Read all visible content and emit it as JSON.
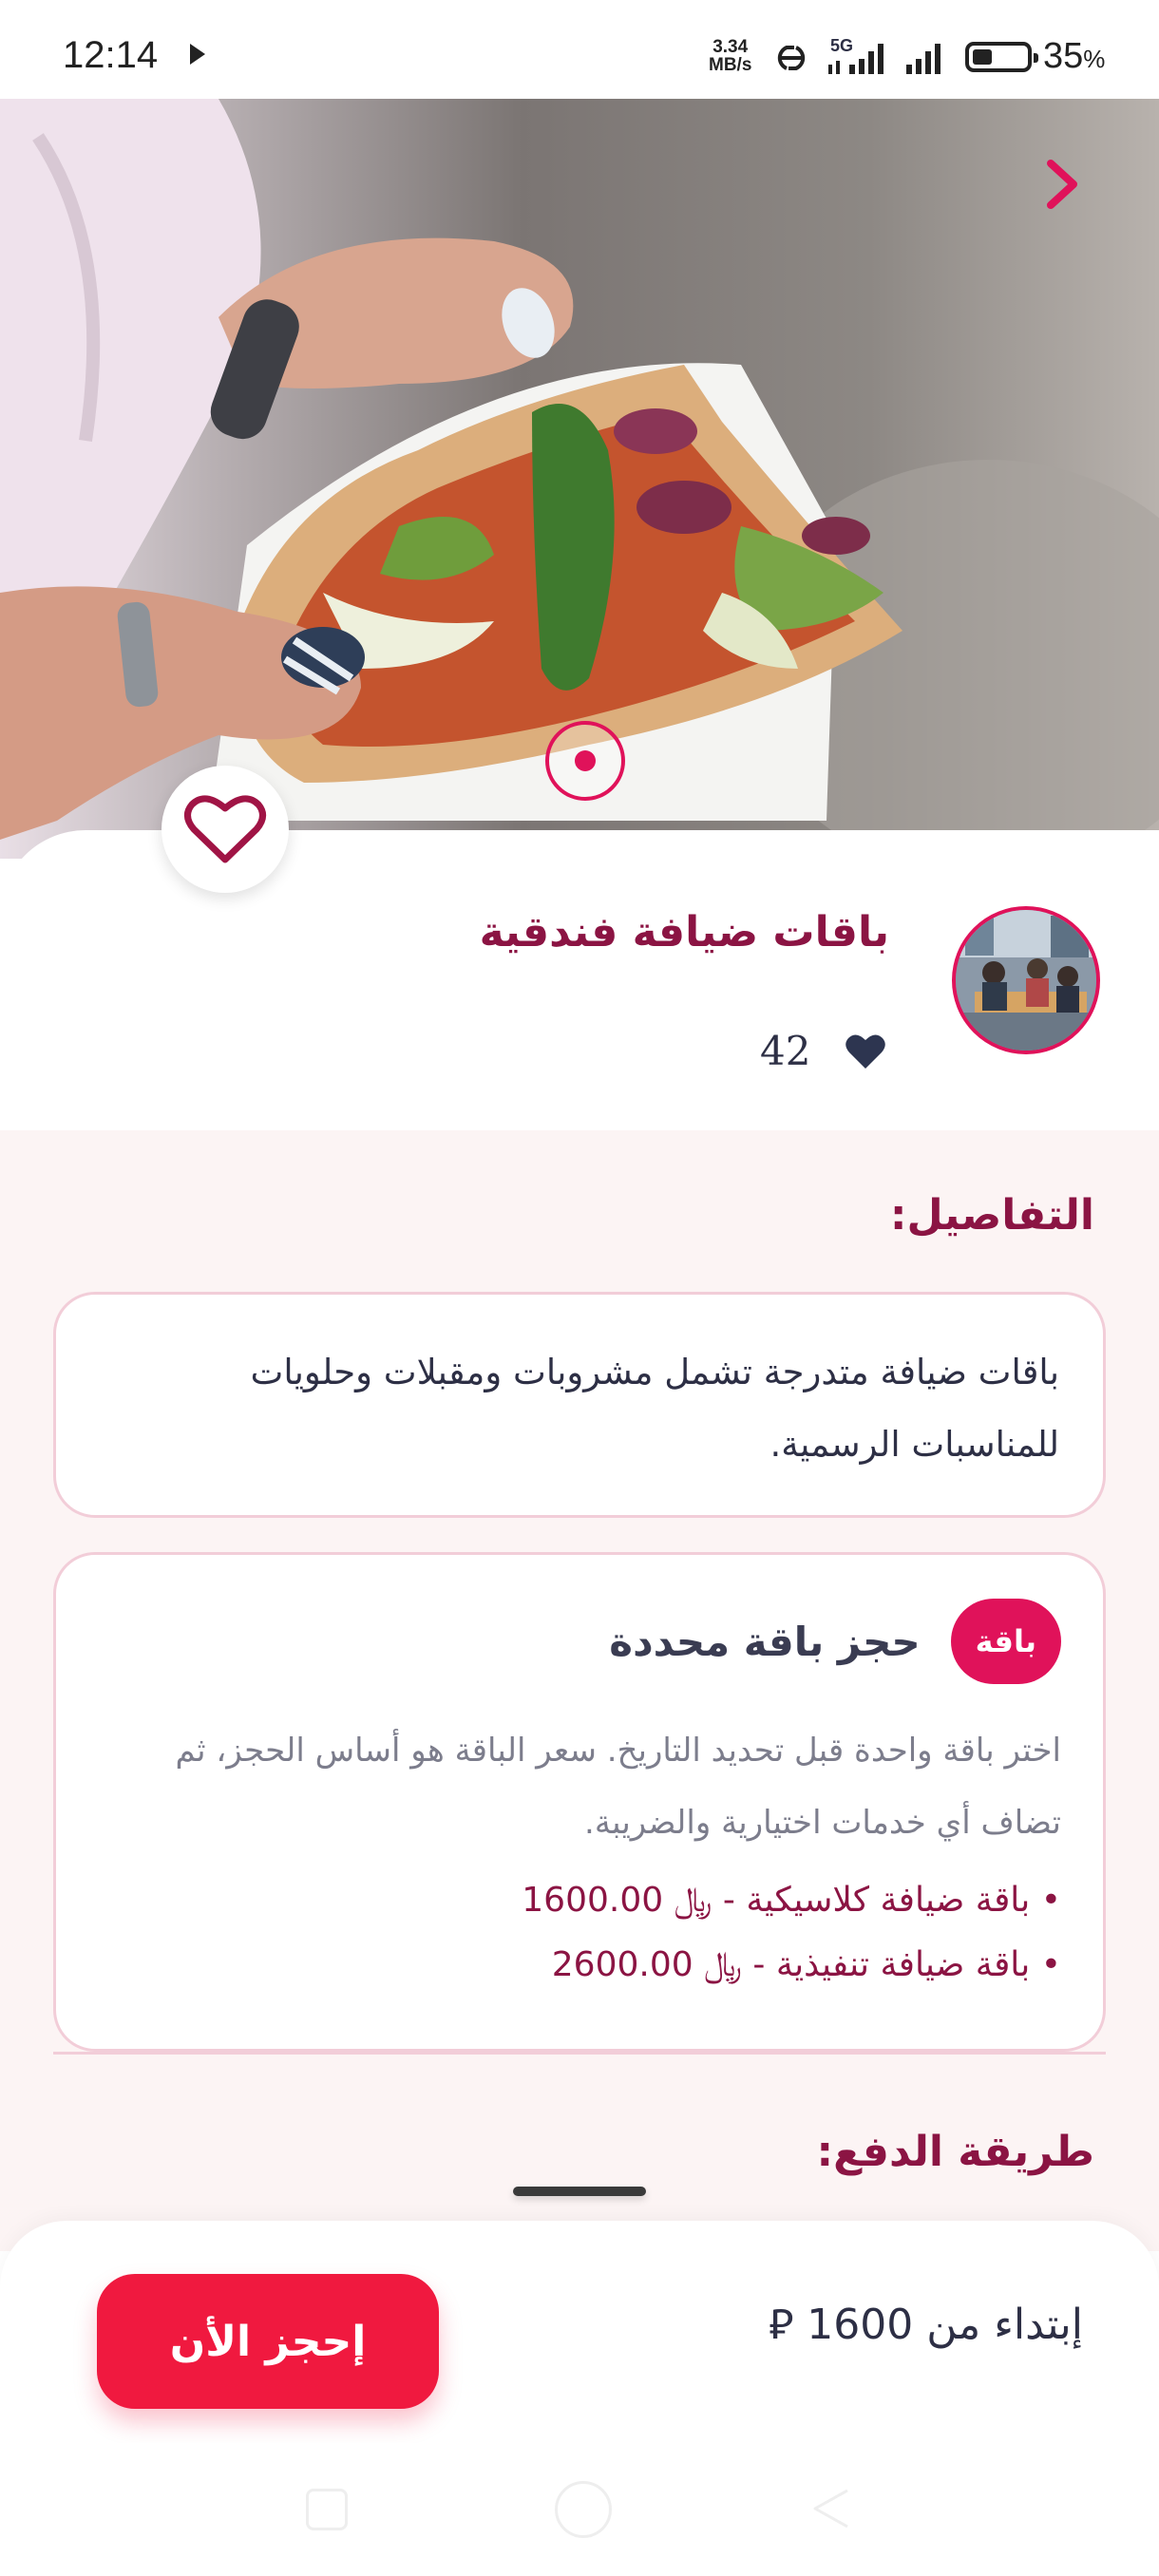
{
  "status_bar": {
    "time": "12:14",
    "speed_value": "3.34",
    "speed_unit": "MB/s",
    "network": "5G",
    "battery_pct": "35",
    "battery_symbol": "%",
    "battery_level": 0.35
  },
  "hero": {
    "image": "pizza-slice-photo",
    "next_icon": "chevron-right-icon",
    "indicator_icon": "carousel-dot-icon"
  },
  "header": {
    "title": "باقات ضيافة فندقية",
    "likes_count": "42",
    "avatar": "office-team-photo"
  },
  "details": {
    "heading": "التفاصيل:",
    "description": "باقات ضيافة متدرجة تشمل مشروبات ومقبلات وحلويات للمناسبات الرسمية."
  },
  "package": {
    "badge": "باقة",
    "title": "حجز باقة محددة",
    "description": "اختر باقة واحدة قبل تحديد التاريخ. سعر الباقة هو أساس الحجز، ثم تضاف أي خدمات اختيارية والضريبة.",
    "options": [
      "باقة ضيافة كلاسيكية - ﷼ 1600.00",
      "باقة ضيافة تنفيذية - ﷼ 2600.00"
    ]
  },
  "payment": {
    "heading": "طريقة الدفع:"
  },
  "footer": {
    "price_label": "إبتداء من 1600 ⃁",
    "book_button": "إحجز الأن"
  },
  "colors": {
    "brand": "#8b1443",
    "accent": "#e0125a",
    "button": "#f0193f",
    "background": "#fcf4f4"
  }
}
